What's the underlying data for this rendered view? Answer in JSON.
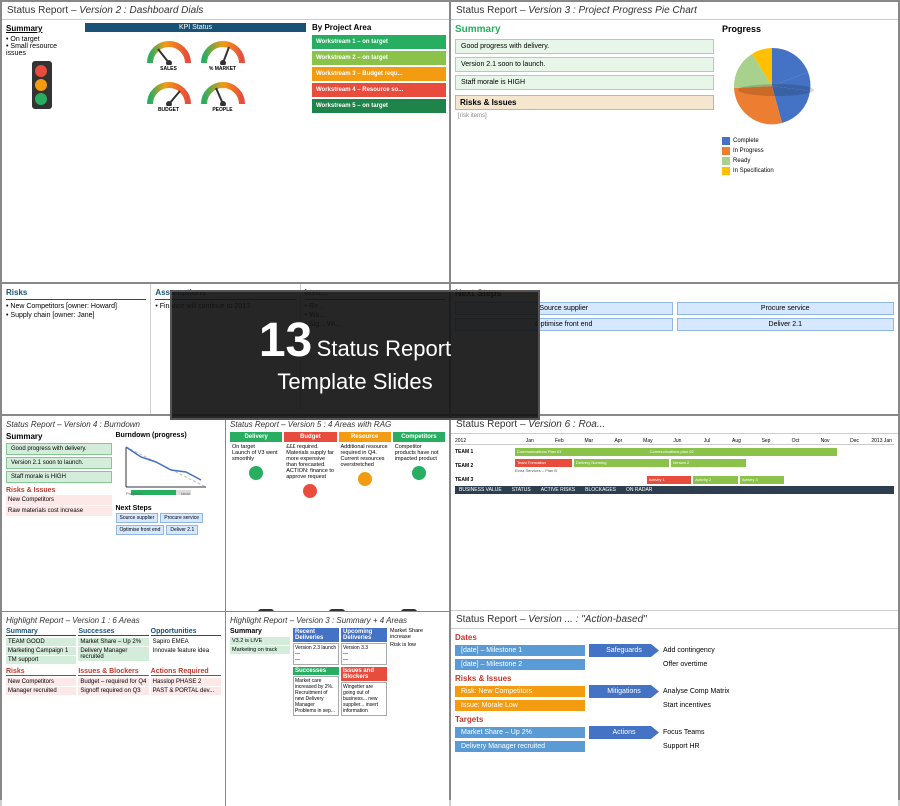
{
  "panels": {
    "panel1": {
      "header": "Status Report",
      "version": "– Version 2 : Dashboard Dials",
      "summary": {
        "title": "Summary",
        "items": [
          "On target",
          "Small resource issues"
        ]
      },
      "kpi": {
        "title": "KPI Status",
        "gauges": [
          {
            "label": "SALES",
            "color": "#e74c3c"
          },
          {
            "label": "% MARKET",
            "color": "#27ae60"
          },
          {
            "label": "BUDGET",
            "color": "#f39c12"
          },
          {
            "label": "PEOPLE",
            "color": "#27ae60"
          }
        ]
      },
      "project": {
        "title": "By Project Area",
        "workstreams": [
          {
            "label": "Workstream 1 – on target",
            "color": "ws-green"
          },
          {
            "label": "Workstream 2 – on target",
            "color": "ws-lime"
          },
          {
            "label": "Workstream 3 – Budget requ...",
            "color": "ws-orange"
          },
          {
            "label": "Workstream 4 – Resource so...",
            "color": "ws-red"
          },
          {
            "label": "Workstream 5 – on target",
            "color": "ws-darkgreen"
          }
        ]
      }
    },
    "panel2": {
      "header": "Status Report",
      "version": "– Version 3 : Project Progress Pie Chart",
      "summary": {
        "title": "Summary",
        "items": [
          "Good progress with delivery.",
          "Version 2.1 soon to launch.",
          "Staff morale is HIGH"
        ]
      },
      "risks": {
        "title": "Risks & Issues"
      },
      "progress": {
        "title": "Progress",
        "legend": [
          {
            "label": "Complete",
            "color": "#4472c4"
          },
          {
            "label": "In Progress",
            "color": "#ed7d31"
          },
          {
            "label": "Ready",
            "color": "#a9d18e"
          },
          {
            "label": "In Specification",
            "color": "#ffc000"
          }
        ]
      },
      "nextSteps": {
        "title": "Next Steps",
        "items": [
          [
            "Source supplier",
            "Procure service"
          ],
          [
            "Optimise front end",
            "Deliver 2.1"
          ]
        ]
      }
    },
    "panel3": {
      "sections": [
        {
          "title": "Risks",
          "items": [
            "New Competitors [owner: Howard]",
            "Supply chain [owner: Jane]"
          ]
        },
        {
          "title": "Assumptions",
          "items": [
            "Finance will continue to 2013"
          ]
        },
        {
          "title": "Issu...",
          "items": [
            "Re...",
            "Wo...",
            "Sig... Wi..."
          ]
        }
      ]
    },
    "overlay": {
      "number": "13",
      "line1": "Status Report",
      "line2": "Template Slides"
    },
    "panel6_action": {
      "header": "Status Report",
      "version": "– Version ... : \"Action-based\"",
      "dates_title": "Dates",
      "dates": [
        "[date] – Milestone 1",
        "[date] – Milestone 2"
      ],
      "safeguards_label": "Safeguards",
      "safeguards": [
        "Add contingency",
        "Offer overtime"
      ],
      "risks_title": "Risks & Issues",
      "risks": [
        "Risk: New Competitors",
        "Issue: Morale Low"
      ],
      "mitigations_label": "Mitigations",
      "mitigations": [
        "Analyse Comp Matrix",
        "Start incentives"
      ],
      "targets_title": "Targets",
      "targets": [
        "Market Share – Up 2%",
        "Delivery Manager recruited"
      ],
      "actions_label": "Actions",
      "actions": [
        "Focus Teams",
        "Support HR"
      ]
    },
    "bottom_panels": {
      "bp1": {
        "header": "Status Report – Version 4 : Burndown",
        "summary_title": "Summary",
        "summary_items": [
          "Good progress with delivery.",
          "Version 2.1 soon to launch.",
          "Staff morale is HIGH"
        ],
        "burndown_title": "Burndown (progress)",
        "risks_title": "Risks & Issues",
        "risks": [
          "New Competitors",
          "Raw materials cost increase"
        ],
        "nextsteps_title": "Next Steps",
        "nextsteps": [
          "Source supplier",
          "Procure service",
          "Optimise front end",
          "Deliver 2.1"
        ]
      },
      "bp2": {
        "header": "Status Report – Version 5 : 4 Areas with RAG",
        "cols": [
          "Delivery",
          "Budget",
          "Resource",
          "Competitors"
        ],
        "delivery": "On target\nLaunch of V3 went smoothly",
        "budget": "£££ required\nMaterials supply far more expensive than forecasted\nACTION: finance to approve request",
        "resource": "Additional resource required in Q4\nCurrent resources overstretched",
        "competitors": "Competitor products have not impacted product"
      },
      "bp3": {
        "header": "Highlight Report – Version 1 : 6 Areas",
        "sections": [
          "Summary",
          "Successes",
          "Opportunities",
          "Risks",
          "Issues & Blockers",
          "Actions Required"
        ],
        "team_good": "TEAM GOOD",
        "marketing": "Marketing Campaign 1",
        "delivery": "Delivery Manager recruited"
      },
      "bp4": {
        "header": "Highlight Report – Version 3 : Summary + 4 Areas",
        "sections": [
          "Recent Deliveries",
          "Upcoming Deliveries",
          "Successes",
          "Issues and Blockers"
        ],
        "summary_items": [
          "V3.2 is LIVE",
          "Marketing on track"
        ],
        "opp": [
          "Market Share increase",
          "Risk is low"
        ]
      }
    }
  }
}
